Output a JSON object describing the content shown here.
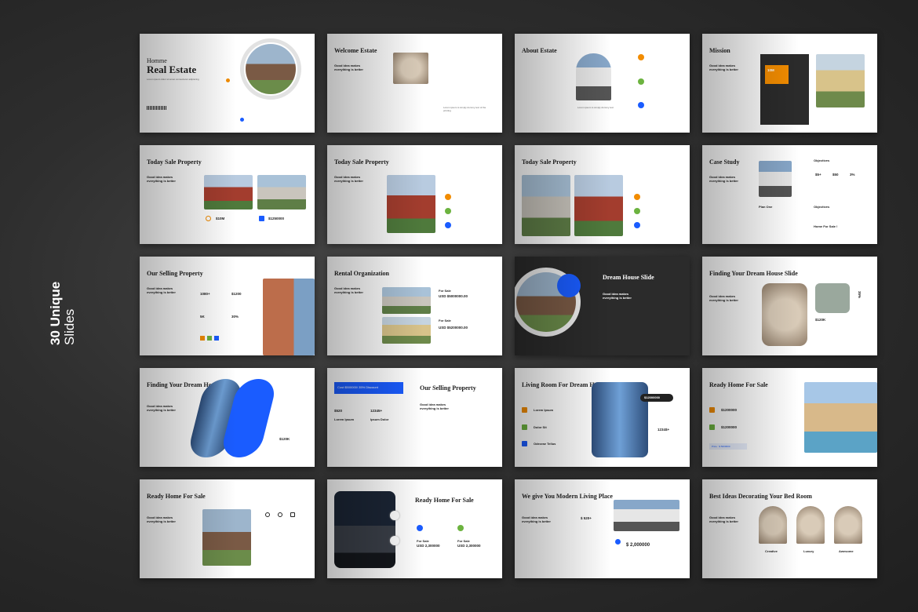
{
  "side": {
    "line1": "30 Unique",
    "line2": "Slides"
  },
  "colors": {
    "accent_blue": "#1a5cff",
    "accent_orange": "#f28c00",
    "accent_green": "#6cb33f",
    "dark_slide": "#2b2b2b"
  },
  "slides": {
    "s1": {
      "title_small": "Homme",
      "title_big": "Real Estate"
    },
    "s2": {
      "title": "Welcome Estate",
      "sub": "Good idea makes everything is better"
    },
    "s3": {
      "title": "About Estate",
      "sub": "Good idea makes everything is better"
    },
    "s4": {
      "title": "Mission",
      "sub": "Good idea makes everything is better",
      "stat": "10M"
    },
    "s5": {
      "title": "Today Sale Property",
      "sub": "Good idea makes everything is better",
      "p1": "$10M",
      "p2": "$1250000"
    },
    "s6": {
      "title": "Today Sale Property",
      "sub": "Good idea makes everything is better"
    },
    "s7": {
      "title": "Today Sale Property"
    },
    "s8": {
      "title": "Case Study",
      "sub": "Good idea makes everything is better",
      "h1": "Objectives",
      "h2": "Objectives",
      "v1": "$5+",
      "v2": "$50",
      "v3": "3%",
      "plan": "Plan One",
      "cta": "Home For Sale !"
    },
    "s9": {
      "title": "Our Selling Property",
      "sub": "Good idea makes everything is better",
      "n1": "1080+",
      "n2": "$1200",
      "n3": "5K",
      "n4": "30%"
    },
    "s10": {
      "title": "Rental Organization",
      "sub": "Good idea makes everything is better",
      "l1": "For Sale",
      "p1": "USD $5000000.00",
      "l2": "For Sale",
      "p2": "USD $5200000.00"
    },
    "s11": {
      "title": "Dream House Slide",
      "sub": "Good idea makes everything is better"
    },
    "s12": {
      "title": "Finding Your Dream House Slide",
      "sub": "Good idea makes everything is better",
      "pct": "35%",
      "price": "$120K"
    },
    "s13": {
      "title": "Finding Your Dream House Slide",
      "sub": "Good idea makes everything is better",
      "price": "$120K"
    },
    "s14": {
      "banner": "Cost $500000/ 35% Discount",
      "title": "Our Selling Property",
      "sub": "Good idea makes everything is better",
      "n1": "$520",
      "n2": "12345+",
      "l1": "Lorem Ipsum",
      "l2": "Ipsum Dolor"
    },
    "s15": {
      "title": "Living Room For Dream House",
      "i1": "Lorem Ipsum",
      "i2": "Dolor Sit",
      "i3": "Odecrae Tellus",
      "price": "$12000000",
      "n": "1234$+"
    },
    "s16": {
      "title": "Ready Home For Sale",
      "p1": "$1200000",
      "p2": "$1200000",
      "price": "Price : $ 5000000"
    },
    "s17": {
      "title": "Ready Home For Sale",
      "sub": "Good idea makes everything is better"
    },
    "s18": {
      "title": "Ready Home For Sale",
      "l1": "For Sale",
      "p1": "USD 2,300000",
      "l2": "For Sale",
      "p2": "USD 2,300000"
    },
    "s19": {
      "title": "We give You Modern Living Place",
      "sub": "Good idea makes everything is better",
      "n": "$ 520+",
      "price": "$ 2,000000"
    },
    "s20": {
      "title": "Best Ideas Decorating Your Bed Room",
      "sub": "Good idea makes everything is better",
      "c1": "Creative",
      "c2": "Luxury",
      "c3": "Awesome"
    }
  }
}
